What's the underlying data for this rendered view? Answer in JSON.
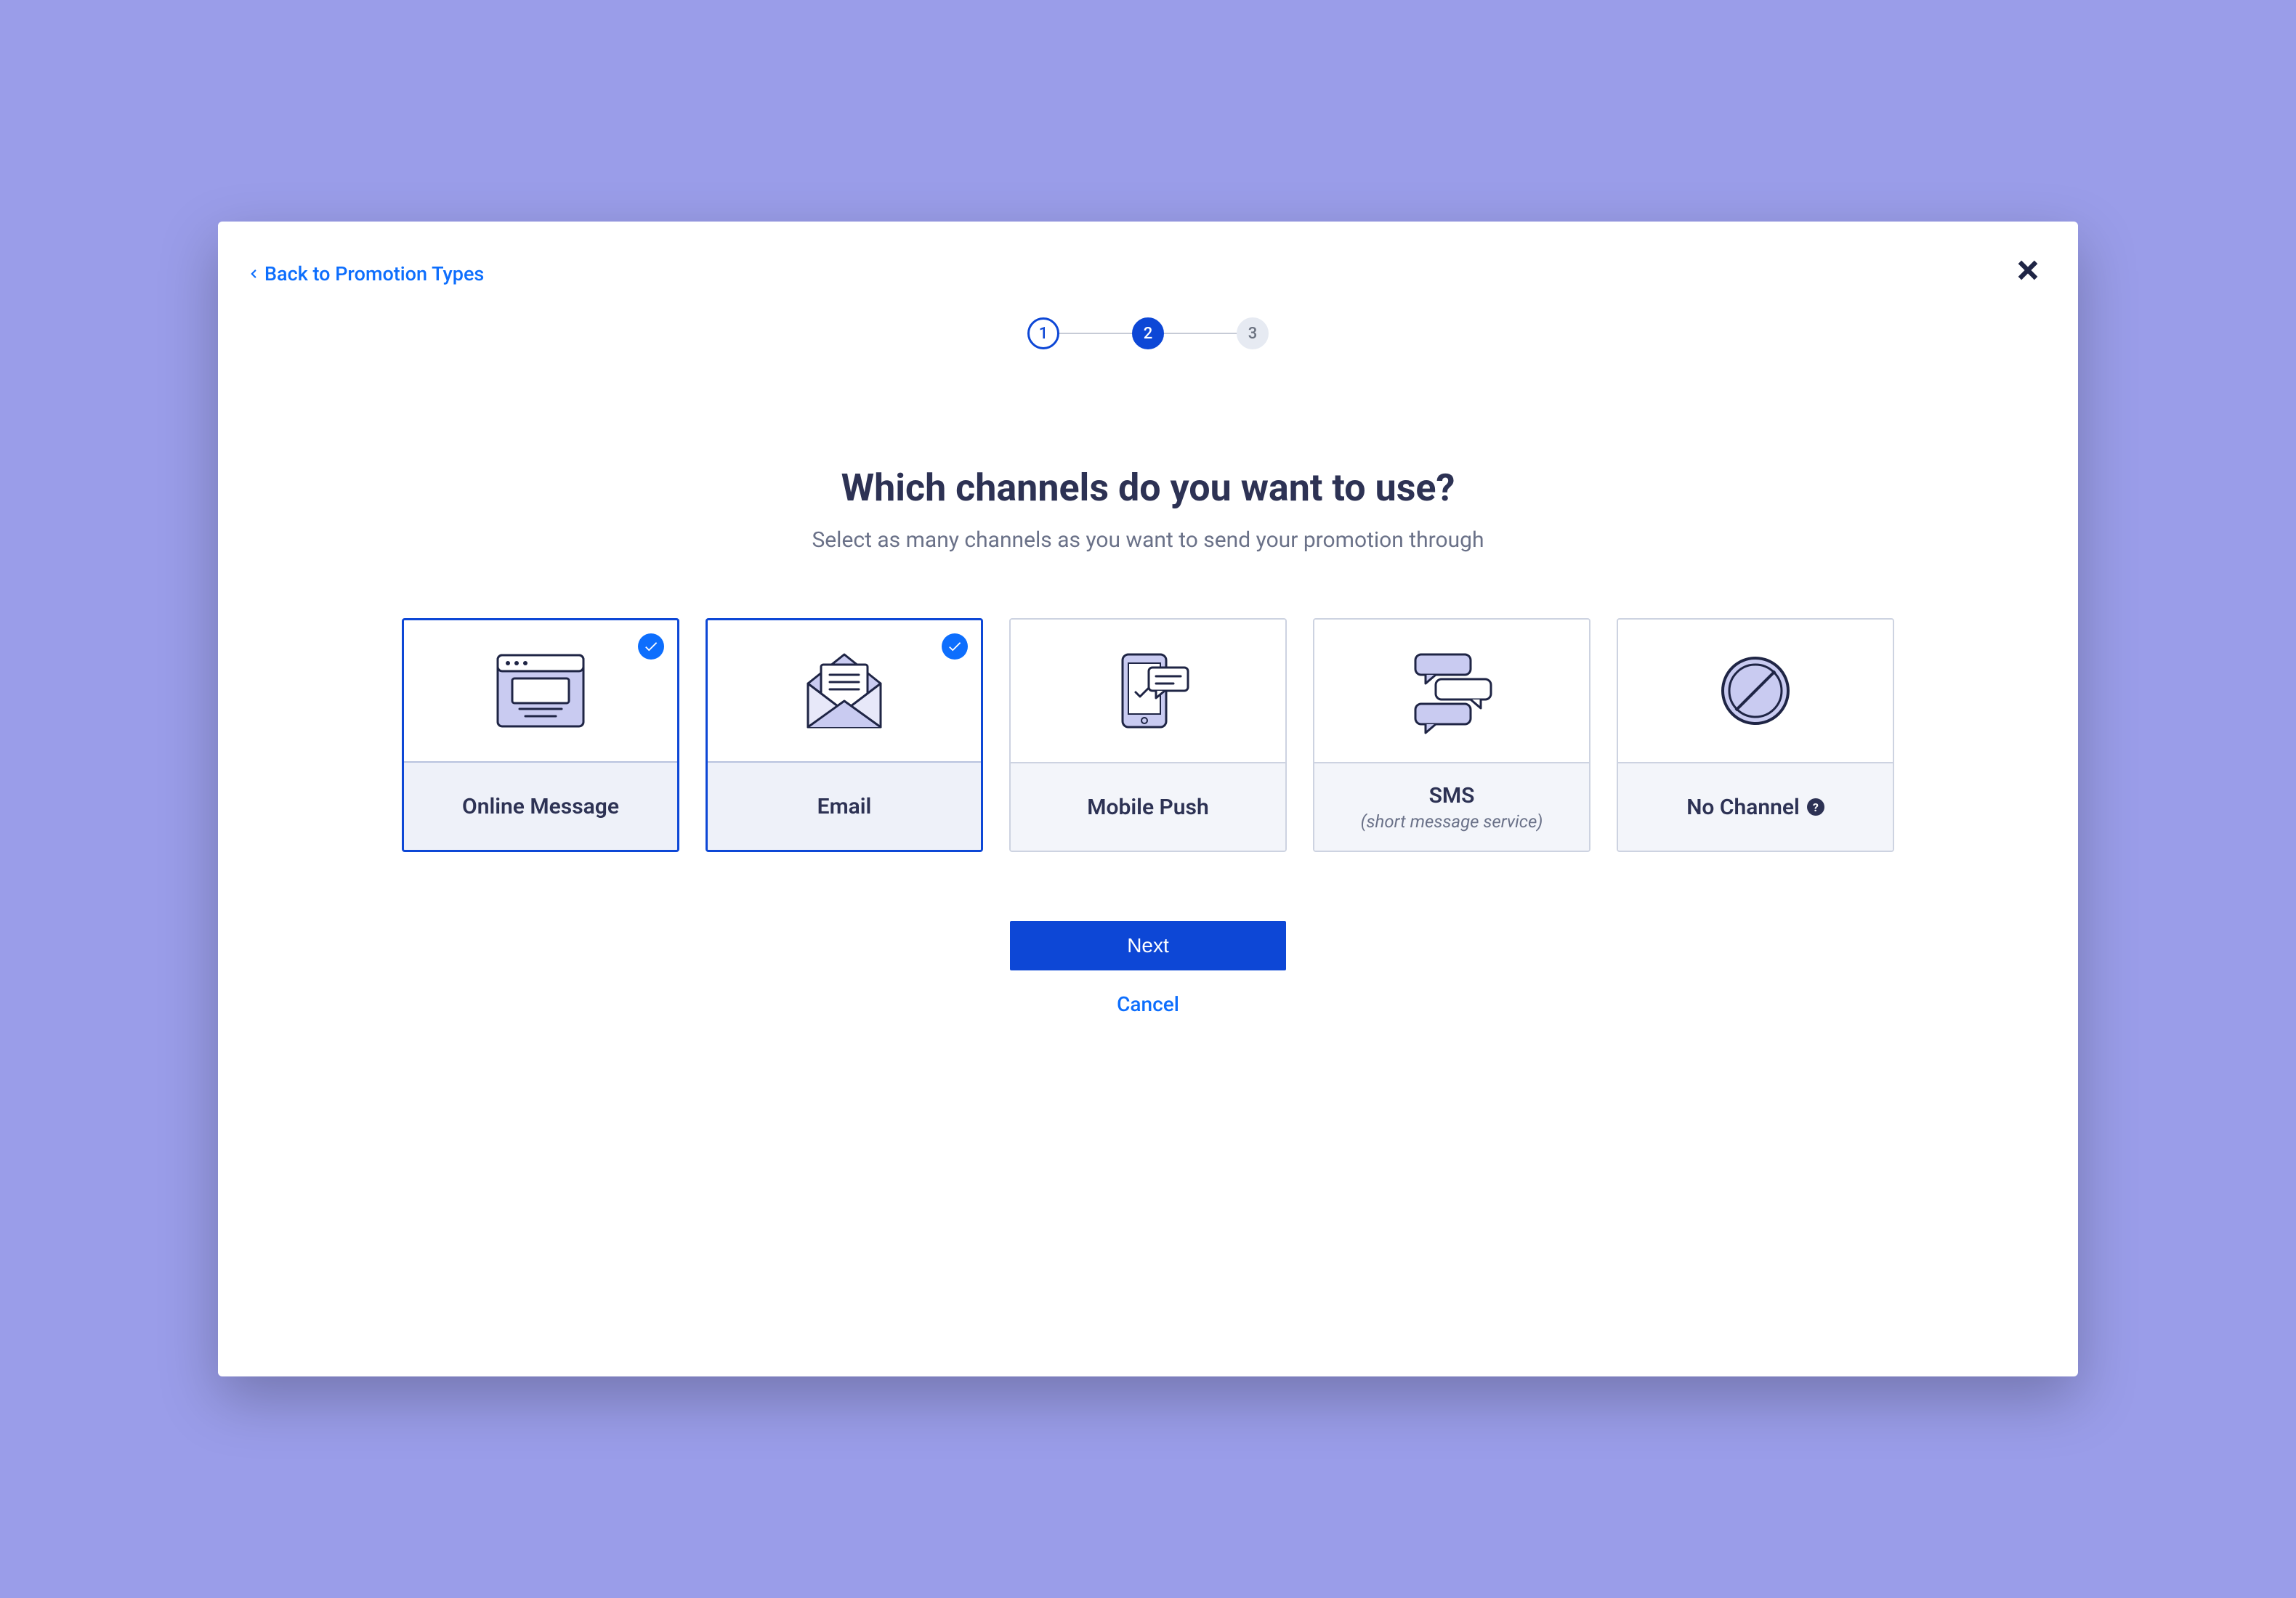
{
  "back_link": "Back to Promotion Types",
  "stepper": {
    "step1": "1",
    "step2": "2",
    "step3": "3",
    "current": 2
  },
  "heading": {
    "title": "Which channels do you want to use?",
    "subtitle": "Select as many channels as you want to send your promotion through"
  },
  "channels": [
    {
      "id": "online-message",
      "label": "Online Message",
      "selected": true
    },
    {
      "id": "email",
      "label": "Email",
      "selected": true
    },
    {
      "id": "mobile-push",
      "label": "Mobile Push",
      "selected": false
    },
    {
      "id": "sms",
      "label": "SMS",
      "sublabel": "(short message service)",
      "selected": false
    },
    {
      "id": "no-channel",
      "label": "No Channel",
      "selected": false,
      "help": true
    }
  ],
  "actions": {
    "next": "Next",
    "cancel": "Cancel"
  },
  "colors": {
    "primary": "#0d47d6",
    "link": "#0d6efd",
    "text_dark": "#2d3254",
    "text_muted": "#6a7188",
    "border": "#cdd3e1",
    "page_bg": "#9a9de9"
  }
}
